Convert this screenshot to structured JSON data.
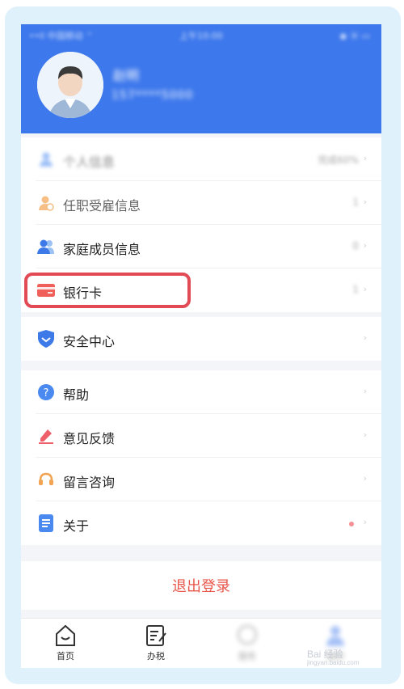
{
  "status_bar": {
    "left": "••ll 中国移动 ⌃",
    "time": "上午10:00",
    "right": "◉ ⦿ ▭"
  },
  "profile": {
    "name": "赵明",
    "phone": "157****5000"
  },
  "menu": {
    "personal_info": {
      "label": "个人信息",
      "value": "完成60%"
    },
    "employment_info": {
      "label": "任职受雇信息",
      "value": "1"
    },
    "family_info": {
      "label": "家庭成员信息",
      "value": "0"
    },
    "bank_card": {
      "label": "银行卡",
      "value": "1"
    },
    "security_center": {
      "label": "安全中心"
    },
    "help": {
      "label": "帮助"
    },
    "feedback": {
      "label": "意见反馈"
    },
    "consult": {
      "label": "留言咨询"
    },
    "about": {
      "label": "关于"
    }
  },
  "chevron": "›",
  "logout_label": "退出登录",
  "tabs": [
    {
      "label": "首页",
      "icon": "home-icon"
    },
    {
      "label": "办税",
      "icon": "tax-form-icon"
    },
    {
      "label": "服务",
      "icon": "service-icon"
    },
    {
      "label": "我的",
      "icon": "user-icon"
    }
  ],
  "watermark": {
    "main": "Bai 经验",
    "sub": "jingyan.baidu.com"
  },
  "colors": {
    "header_blue": "#3d78ec",
    "highlight_red": "#e24a55",
    "logout_red": "#e8564a"
  }
}
